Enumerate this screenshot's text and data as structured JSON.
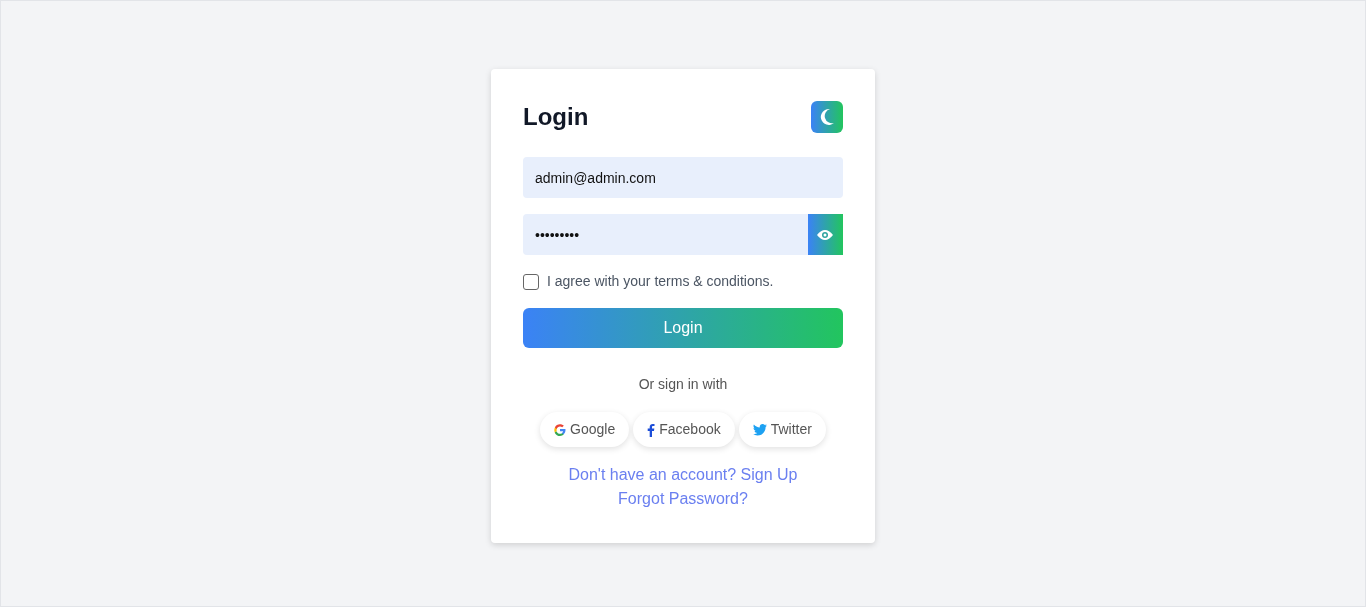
{
  "title": "Login",
  "theme_toggle": {
    "dark": false
  },
  "email": {
    "value": "admin@admin.com"
  },
  "password": {
    "value": "•••••••••"
  },
  "terms": {
    "label": "I agree with your terms & conditions.",
    "checked": false
  },
  "login_button": "Login",
  "divider_text": "Or sign in with",
  "social": [
    {
      "kind": "google",
      "label": "Google"
    },
    {
      "kind": "facebook",
      "label": "Facebook"
    },
    {
      "kind": "twitter",
      "label": "Twitter"
    }
  ],
  "links": [
    "Don't have an account? Sign Up",
    "Forgot Password?"
  ]
}
